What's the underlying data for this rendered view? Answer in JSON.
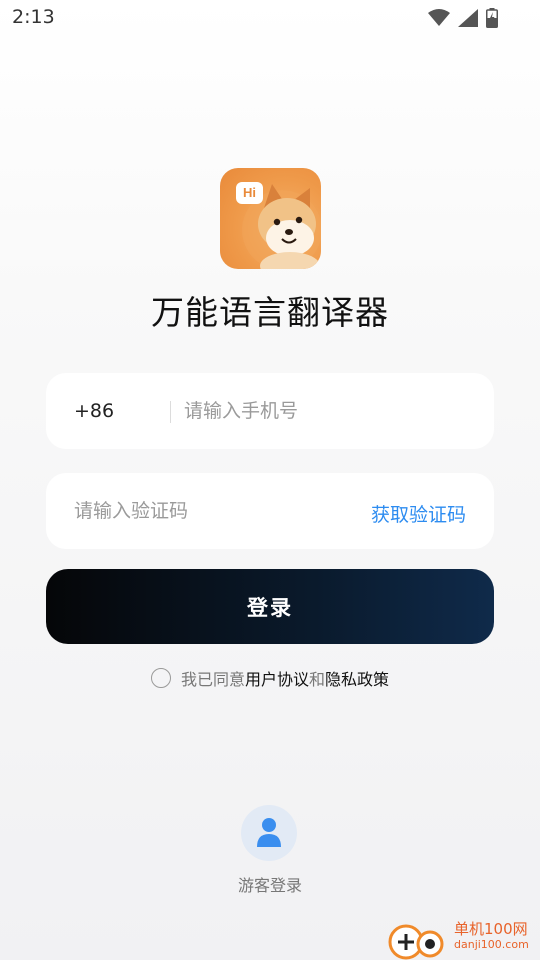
{
  "status_bar": {
    "time": "2:13",
    "icons": [
      "wifi-icon",
      "signal-icon",
      "battery-charging-icon"
    ]
  },
  "app": {
    "logo_badge": "Hi",
    "title": "万能语言翻译器"
  },
  "phone_field": {
    "country_code": "+86",
    "placeholder": "请输入手机号",
    "value": ""
  },
  "code_field": {
    "placeholder": "请输入验证码",
    "value": "",
    "get_code_label": "获取验证码"
  },
  "login_button": {
    "label": "登录"
  },
  "agreement": {
    "checked": false,
    "prefix": "我已同意",
    "user_agreement": "用户协议",
    "and": "和",
    "privacy_policy": "隐私政策"
  },
  "guest": {
    "label": "游客登录"
  },
  "watermark": {
    "text": "单机100网",
    "sub": "danji100.com"
  },
  "colors": {
    "accent": "#2d8cf0",
    "button_start": "#050608",
    "button_end": "#0f2a4a",
    "logo_orange": "#ef9a4a"
  }
}
